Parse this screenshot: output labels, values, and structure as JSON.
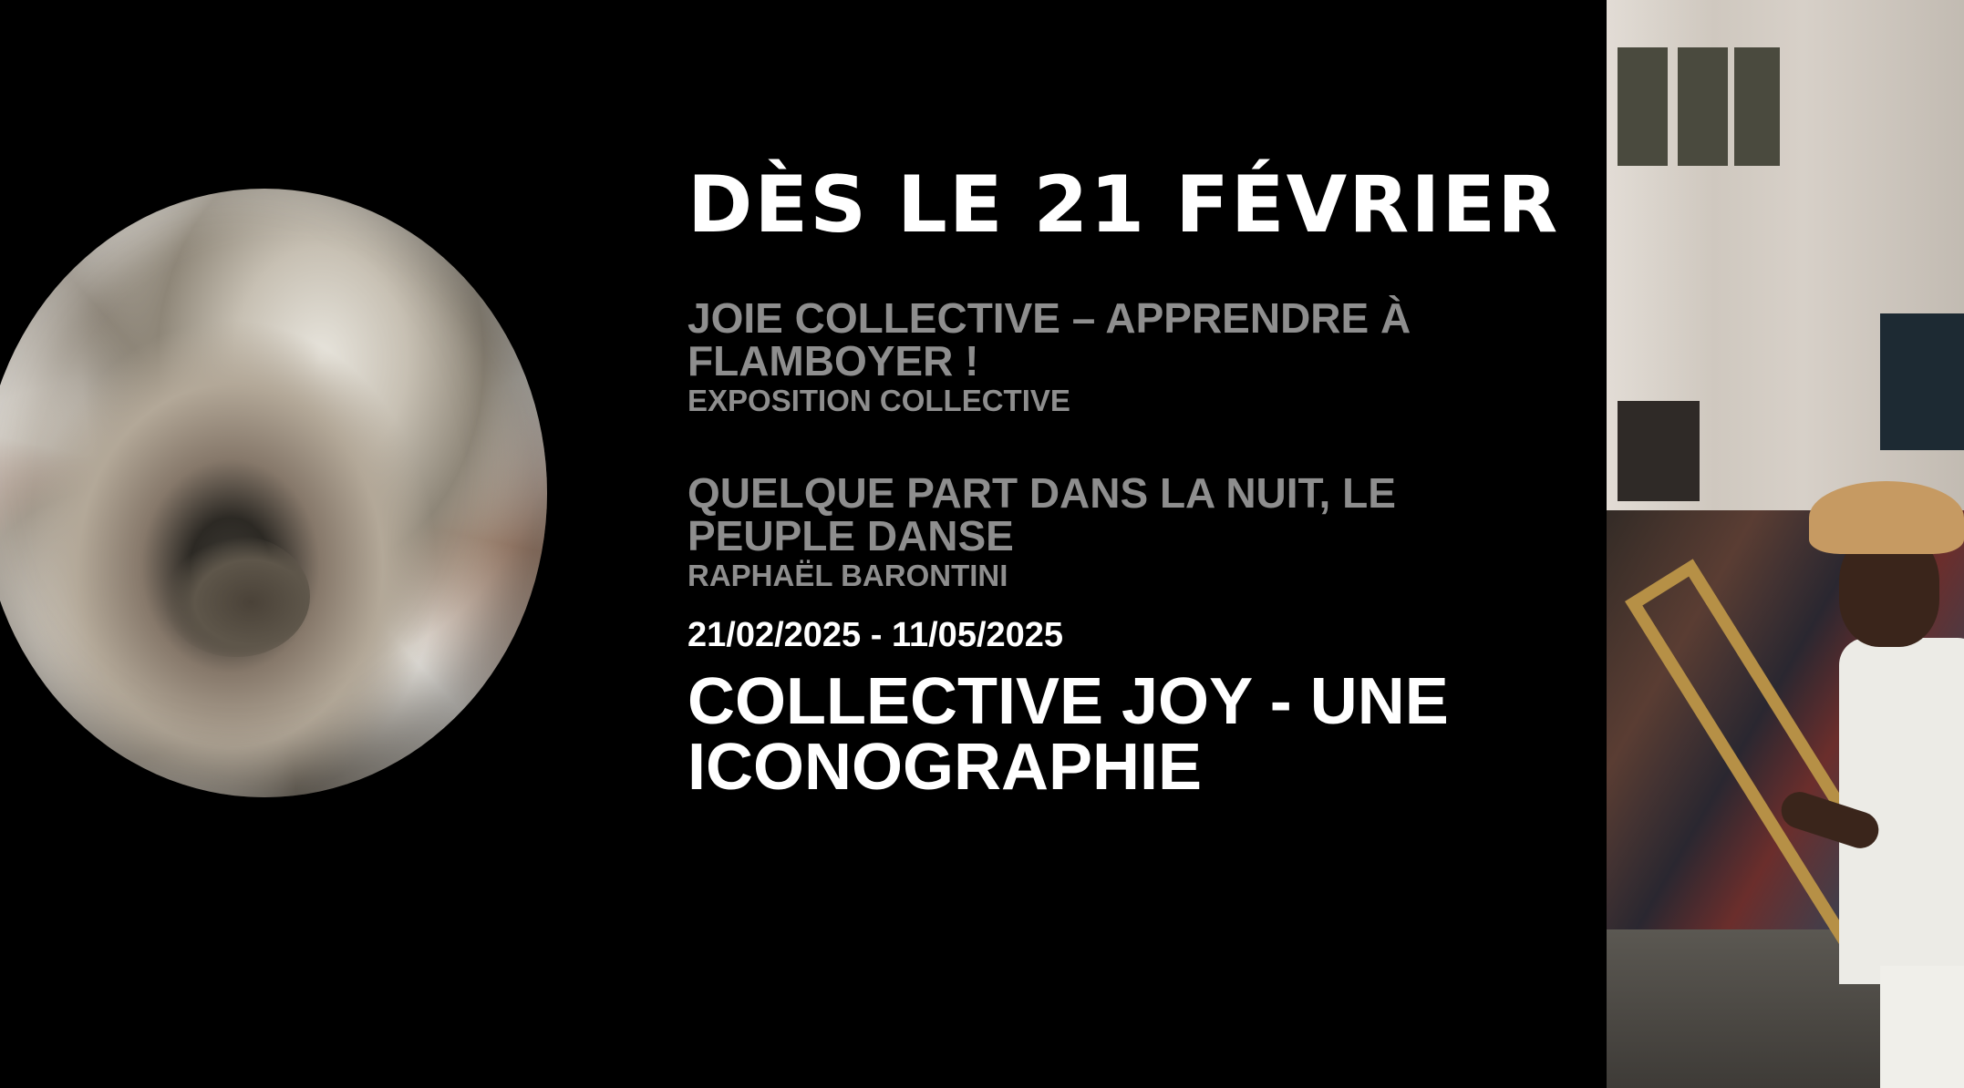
{
  "headline": "DÈS LE 21 FÉVRIER",
  "events": [
    {
      "title": "JOIE COLLECTIVE – APPRENDRE À FLAMBOYER !",
      "subtitle": "EXPOSITION COLLECTIVE"
    },
    {
      "title": "QUELQUE PART DANS LA NUIT, LE PEUPLE DANSE",
      "subtitle": "RAPHAËL BARONTINI"
    }
  ],
  "dates": "21/02/2025 - 11/05/2025",
  "feature_title": "COLLECTIVE JOY - UNE ICONOGRAPHIE",
  "colors": {
    "background": "#000000",
    "muted_text": "#8e8e8e",
    "text": "#ffffff"
  }
}
